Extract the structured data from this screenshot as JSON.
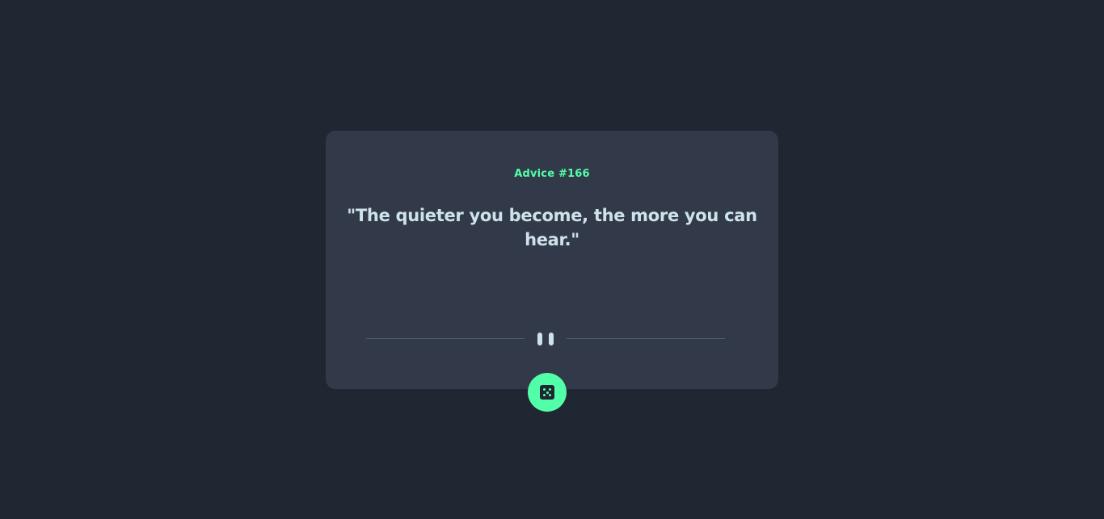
{
  "advice": {
    "label": "Advice #166",
    "quote": "\"The quieter you become, the more you can hear.\""
  },
  "divider": {
    "icon": "pause-icon"
  },
  "dice_button": {
    "icon": "dice-icon"
  },
  "colors": {
    "background": "#202632",
    "card": "#323a49",
    "accent": "#52ffa8",
    "text": "#cee3e9",
    "divider": "#4f5d74"
  }
}
